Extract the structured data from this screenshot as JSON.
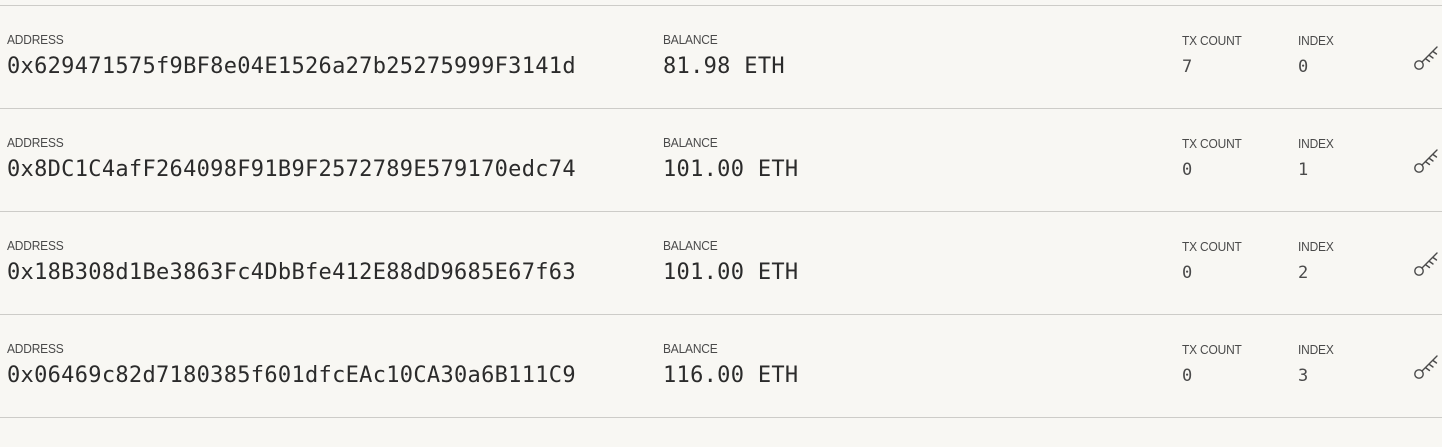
{
  "columns": {
    "address_label": "ADDRESS",
    "balance_label": "BALANCE",
    "tx_count_label": "TX COUNT",
    "index_label": "INDEX"
  },
  "accounts": [
    {
      "address": "0x629471575f9BF8e04E1526a27b25275999F3141d",
      "balance": "81.98 ETH",
      "tx_count": "7",
      "index": "0",
      "icon": "key-icon"
    },
    {
      "address": "0x8DC1C4afF264098F91B9F2572789E579170edc74",
      "balance": "101.00 ETH",
      "tx_count": "0",
      "index": "1",
      "icon": "key-icon"
    },
    {
      "address": "0x18B308d1Be3863Fc4DbBfe412E88dD9685E67f63",
      "balance": "101.00 ETH",
      "tx_count": "0",
      "index": "2",
      "icon": "key-icon"
    },
    {
      "address": "0x06469c82d7180385f601dfcEAc10CA30a6B111C9",
      "balance": "116.00 ETH",
      "tx_count": "0",
      "index": "3",
      "icon": "key-icon"
    }
  ],
  "colors": {
    "background": "#f8f7f3",
    "divider": "#cdccc8",
    "text": "#2b2b2b"
  }
}
